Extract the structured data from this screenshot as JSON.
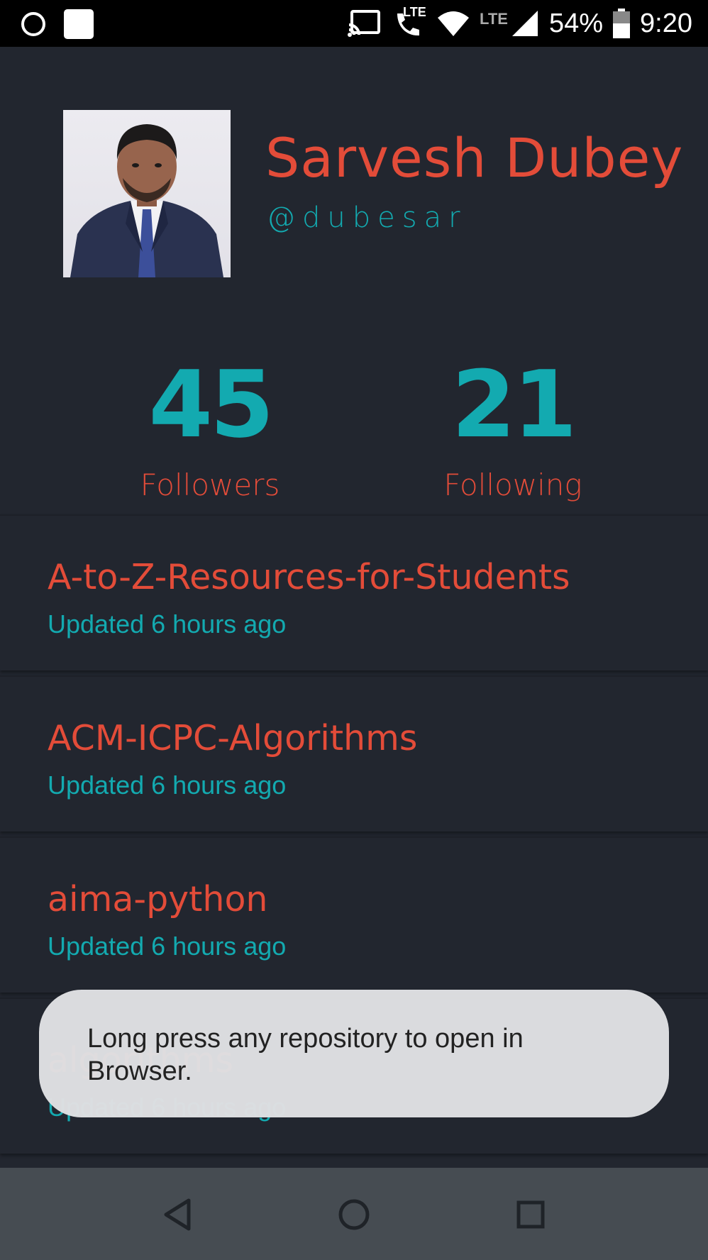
{
  "status_bar": {
    "battery": "54%",
    "time": "9:20",
    "lte_label": "LTE",
    "lte_call_label": "LTE",
    "icons": [
      "circle-notification-icon",
      "square-notification-icon",
      "cast-icon",
      "lte-call-icon",
      "wifi-icon",
      "cell-signal-icon",
      "battery-icon"
    ]
  },
  "profile": {
    "name": "Sarvesh Dubey",
    "handle": "@dubesar"
  },
  "stats": {
    "followers_count": "45",
    "followers_label": "Followers",
    "following_count": "21",
    "following_label": "Following"
  },
  "repos": [
    {
      "name": "A-to-Z-Resources-for-Students",
      "updated": "Updated 6 hours ago"
    },
    {
      "name": "ACM-ICPC-Algorithms",
      "updated": "Updated 6 hours ago"
    },
    {
      "name": "aima-python",
      "updated": "Updated 6 hours ago"
    },
    {
      "name": "algorithms",
      "updated": "Updated 6 hours ago"
    }
  ],
  "toast": {
    "message": "Long press any repository to open in Browser."
  },
  "nav": {
    "icons": [
      "back-icon",
      "home-icon",
      "recents-icon"
    ]
  },
  "colors": {
    "background": "#22262f",
    "accent_red": "#e34c39",
    "accent_teal": "#13aab0",
    "nav_bar": "#464c52"
  }
}
